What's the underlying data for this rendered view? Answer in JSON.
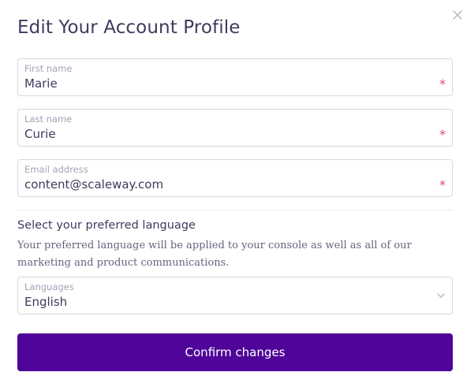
{
  "dialog": {
    "title": "Edit Your Account Profile",
    "close_icon": "close-icon"
  },
  "fields": {
    "first_name": {
      "label": "First name",
      "value": "Marie",
      "required_mark": "*"
    },
    "last_name": {
      "label": "Last name",
      "value": "Curie",
      "required_mark": "*"
    },
    "email": {
      "label": "Email address",
      "value": "content@scaleway.com",
      "required_mark": "*"
    }
  },
  "language_section": {
    "heading": "Select your preferred language",
    "description": "Your preferred language will be applied to your console as well as all of our marketing and product communications.",
    "select": {
      "label": "Languages",
      "value": "English",
      "icon": "chevron-down-icon"
    }
  },
  "actions": {
    "confirm_label": "Confirm changes"
  },
  "colors": {
    "primary": "#4f0599",
    "required": "#e0457b",
    "border": "#d7d8e0",
    "text": "#3d3b5e"
  }
}
